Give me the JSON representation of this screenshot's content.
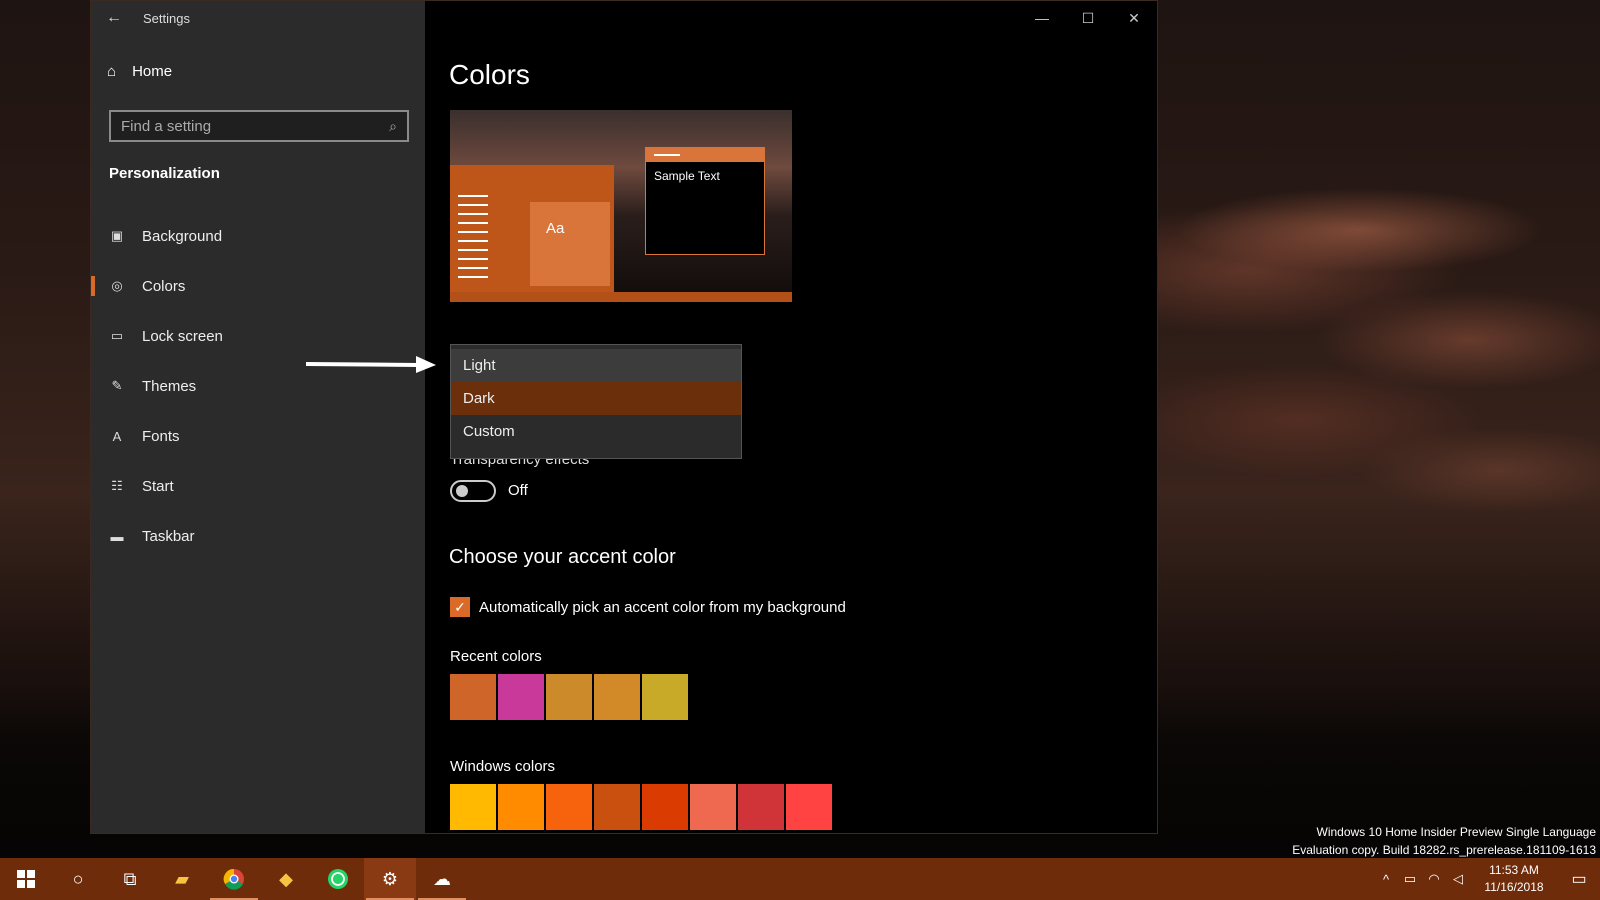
{
  "window": {
    "title": "Settings",
    "controls": {
      "minimize": "—",
      "maximize": "☐",
      "close": "✕"
    }
  },
  "sidebar": {
    "home_label": "Home",
    "search_placeholder": "Find a setting",
    "section_title": "Personalization",
    "items": [
      {
        "label": "Background",
        "icon": "image-icon"
      },
      {
        "label": "Colors",
        "icon": "palette-icon",
        "active": true
      },
      {
        "label": "Lock screen",
        "icon": "lock-screen-icon"
      },
      {
        "label": "Themes",
        "icon": "themes-icon"
      },
      {
        "label": "Fonts",
        "icon": "fonts-icon"
      },
      {
        "label": "Start",
        "icon": "start-icon"
      },
      {
        "label": "Taskbar",
        "icon": "taskbar-icon"
      }
    ]
  },
  "main": {
    "title": "Colors",
    "preview": {
      "sample_text": "Sample Text",
      "tile_text": "Aa"
    },
    "mode_dropdown": {
      "options": [
        "Light",
        "Dark",
        "Custom"
      ],
      "selected": "Dark"
    },
    "transparency": {
      "label": "Transparency effects",
      "state": "Off"
    },
    "accent_heading": "Choose your accent color",
    "auto_pick_label": "Automatically pick an accent color from my background",
    "recent_colors_label": "Recent colors",
    "recent_colors": [
      "#d0652a",
      "#c9399a",
      "#cd8a2a",
      "#d28a28",
      "#c9a928"
    ],
    "windows_colors_label": "Windows colors",
    "windows_colors": [
      "#ffb900",
      "#ff8c00",
      "#f7630c",
      "#ca5010",
      "#da3b01",
      "#ef6950",
      "#d13438",
      "#ff4343"
    ]
  },
  "watermark": {
    "line1": "Windows 10 Home Insider Preview Single Language",
    "line2": "Evaluation copy. Build 18282.rs_prerelease.181109-1613"
  },
  "taskbar": {
    "time": "11:53 AM",
    "date": "11/16/2018"
  },
  "colors": {
    "accent": "#d96a28",
    "taskbar": "#6e2c0a"
  }
}
